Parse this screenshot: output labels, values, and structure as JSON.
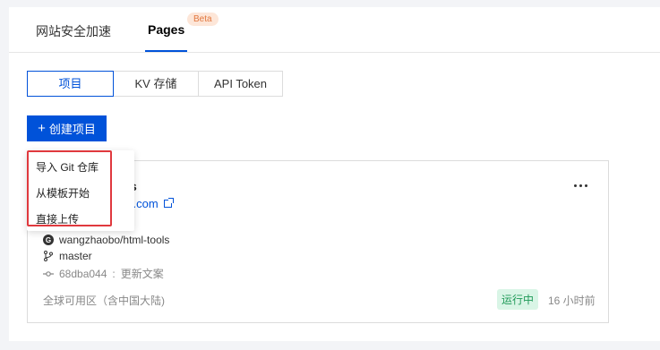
{
  "top_tabs": {
    "tab1": "网站安全加速",
    "tab2": "Pages",
    "badge": "Beta"
  },
  "segments": [
    "项目",
    "KV 存储",
    "API Token"
  ],
  "create_button": {
    "icon": "+",
    "label": "创建项目"
  },
  "menu": {
    "items": [
      "导入 Git 仓库",
      "从模板开始",
      "直接上传"
    ]
  },
  "card": {
    "name_fragment": "s",
    "link_fragment": "s.com",
    "repo": "wangzhaobo/html-tools",
    "branch": "master",
    "commit_hash": "68dba044",
    "commit_message": "更新文案",
    "region": "全球可用区（含中国大陆)",
    "status": "运行中",
    "time": "16 小时前"
  },
  "colors": {
    "accent": "#0052d9",
    "highlight": "#e0393e",
    "status_bg": "#d9f5e6",
    "status_text": "#1f9a58"
  }
}
